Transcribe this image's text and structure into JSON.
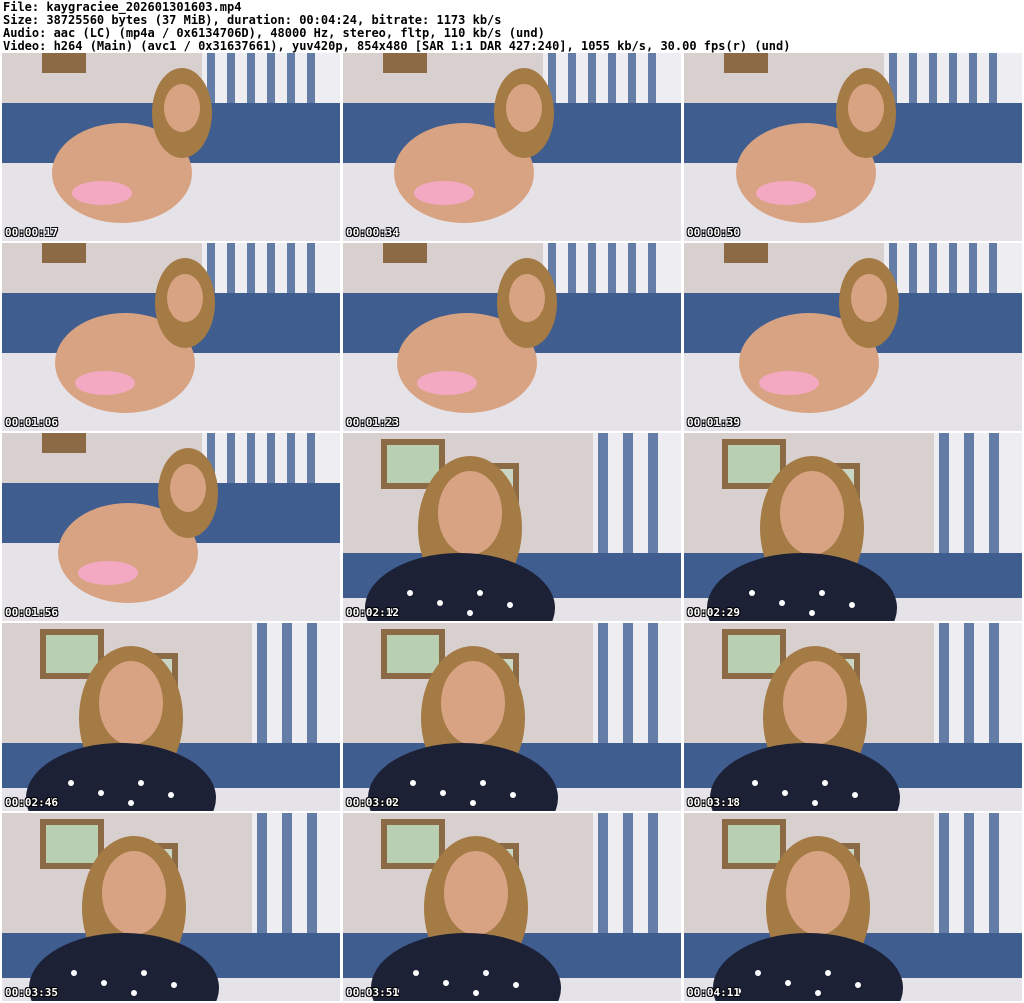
{
  "header": {
    "file": "File: kaygraciee_202601301603.mp4",
    "size": "Size: 38725560 bytes (37 MiB), duration: 00:04:24, bitrate: 1173 kb/s",
    "audio": "Audio: aac (LC) (mp4a / 0x6134706D), 48000 Hz, stereo, fltp, 110 kb/s (und)",
    "video": "Video: h264 (Main) (avc1 / 0x31637661), yuv420p, 854x480 [SAR 1:1 DAR 427:240], 1055 kb/s, 30.00 fps(r) (und)"
  },
  "thumbnails": [
    {
      "time": "00:00:17",
      "scene": "bed-pink"
    },
    {
      "time": "00:00:34",
      "scene": "bed-pink"
    },
    {
      "time": "00:00:50",
      "scene": "bed-pink"
    },
    {
      "time": "00:01:06",
      "scene": "bed-pink"
    },
    {
      "time": "00:01:23",
      "scene": "bed-pink"
    },
    {
      "time": "00:01:39",
      "scene": "bed-pink"
    },
    {
      "time": "00:01:56",
      "scene": "bed-pink"
    },
    {
      "time": "00:02:12",
      "scene": "room-robe"
    },
    {
      "time": "00:02:29",
      "scene": "room-robe"
    },
    {
      "time": "00:02:46",
      "scene": "room-robe"
    },
    {
      "time": "00:03:02",
      "scene": "room-robe"
    },
    {
      "time": "00:03:18",
      "scene": "room-robe"
    },
    {
      "time": "00:03:35",
      "scene": "room-robe"
    },
    {
      "time": "00:03:51",
      "scene": "room-robe"
    },
    {
      "time": "00:04:11",
      "scene": "room-robe"
    }
  ],
  "colors": {
    "wall": "#d8d0cf",
    "curtain": "#4b6a9a",
    "pillow": "#3f5d8f",
    "bedding": "#e6e3e8",
    "hair": "#a47a45",
    "skin": "#d8a383",
    "robe": "#1c2136",
    "pink": "#f4a9c2",
    "frame": "#8c6a45"
  }
}
